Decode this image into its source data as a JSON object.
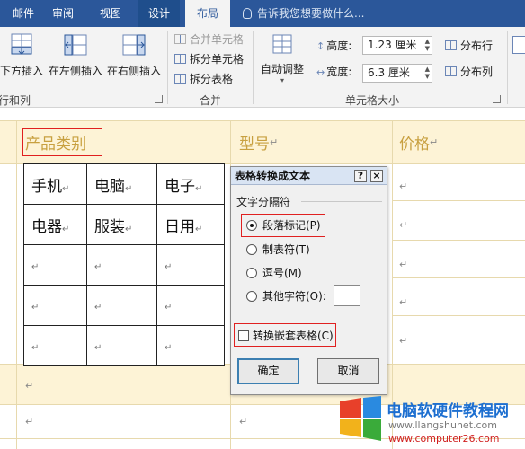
{
  "tabs": [
    {
      "label": "邮件"
    },
    {
      "label": "审阅"
    },
    {
      "label": "视图"
    },
    {
      "label": "设计"
    },
    {
      "label": "布局"
    }
  ],
  "tell_me": "告诉我您想要做什么...",
  "ribbon": {
    "insert_below": "下方插入",
    "insert_left": "在左侧插入",
    "insert_right": "在右侧插入",
    "group_rows_cols": "行和列",
    "merge_cells": "合并单元格",
    "split_cells": "拆分单元格",
    "split_table": "拆分表格",
    "group_merge": "合并",
    "autofit": "自动调整",
    "height_label": "高度:",
    "height_value": "1.23 厘米",
    "width_label": "宽度:",
    "width_value": "6.3 厘米",
    "distribute_rows": "分布行",
    "distribute_cols": "分布列",
    "group_cell_size": "单元格大小"
  },
  "document": {
    "header_cells": [
      "产品类别",
      "型号",
      "价格"
    ],
    "nested_table": [
      [
        "手机",
        "电脑",
        "电子"
      ],
      [
        "电器",
        "服装",
        "日用"
      ],
      [
        "",
        "",
        ""
      ],
      [
        "",
        "",
        ""
      ],
      [
        "",
        "",
        ""
      ]
    ],
    "para_mark": "↵"
  },
  "dialog": {
    "title": "表格转换成文本",
    "help_button": "?",
    "close_button": "×",
    "group_label": "文字分隔符",
    "options": [
      {
        "label": "段落标记(P)",
        "selected": true
      },
      {
        "label": "制表符(T)",
        "selected": false
      },
      {
        "label": "逗号(M)",
        "selected": false
      },
      {
        "label": "其他字符(O):",
        "selected": false
      }
    ],
    "other_char": "-",
    "convert_nested_label": "转换嵌套表格(C)",
    "convert_nested_checked": false,
    "ok_label": "确定",
    "cancel_label": "取消"
  },
  "watermark": {
    "title": "电脑软硬件教程网",
    "url1": "www.llangshunet.com",
    "url2": "www.computer26.com"
  },
  "colors": {
    "ribbon_tab_blue": "#2b579a",
    "highlight_red": "#e02020",
    "table_band": "#fdf3d6"
  }
}
